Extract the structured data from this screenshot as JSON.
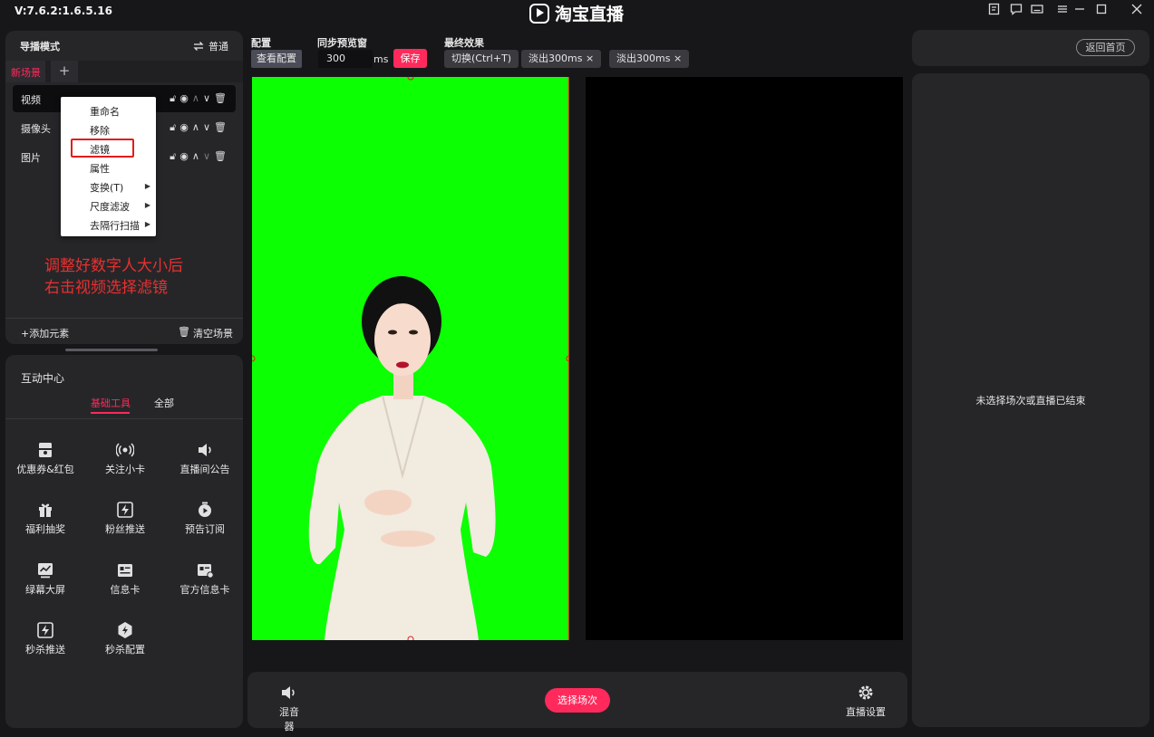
{
  "app": {
    "version": "V:7.6.2:1.6.5.16",
    "brand": "淘宝直播"
  },
  "scene_panel": {
    "mode_label": "导播模式",
    "mode_toggle_label": "普通",
    "active_tab": "新场景",
    "add_tab": "+",
    "layers": [
      {
        "label": "视频"
      },
      {
        "label": "摄像头"
      },
      {
        "label": "图片"
      }
    ],
    "add_element": "+添加元素",
    "clear_scene": "清空场景"
  },
  "context_menu": {
    "items": [
      {
        "label": "重命名"
      },
      {
        "label": "移除"
      },
      {
        "label": "滤镜"
      },
      {
        "label": "属性"
      },
      {
        "label": "变换(T)"
      },
      {
        "label": "尺度滤波"
      },
      {
        "label": "去隔行扫描"
      }
    ],
    "highlighted_item": "滤镜"
  },
  "annotation": {
    "line1": "调整好数字人大小后",
    "line2": "右击视频选择滤镜"
  },
  "interact": {
    "title": "互动中心",
    "tabs": [
      {
        "label": "基础工具",
        "active": true
      },
      {
        "label": "全部",
        "active": false
      }
    ],
    "tools": [
      {
        "label": "优惠券&红包",
        "icon": "coupon-icon"
      },
      {
        "label": "关注小卡",
        "icon": "broadcast-icon"
      },
      {
        "label": "直播间公告",
        "icon": "speaker-icon"
      },
      {
        "label": "福利抽奖",
        "icon": "gift-icon"
      },
      {
        "label": "粉丝推送",
        "icon": "lightning-icon"
      },
      {
        "label": "预告订阅",
        "icon": "alarm-icon"
      },
      {
        "label": "绿幕大屏",
        "icon": "chart-icon"
      },
      {
        "label": "信息卡",
        "icon": "id-card-icon"
      },
      {
        "label": "官方信息卡",
        "icon": "official-card-icon"
      },
      {
        "label": "秒杀推送",
        "icon": "flash-icon"
      },
      {
        "label": "秒杀配置",
        "icon": "flash-gear-icon"
      }
    ]
  },
  "toolbar": {
    "config_label": "配置",
    "view_config_button": "查看配置",
    "sync_label": "同步预览窗",
    "sync_value": "300",
    "sync_unit": "ms",
    "save_button": "保存",
    "effect_label": "最终效果",
    "switch_button": "切换(Ctrl+T)",
    "fade_chip_1": "淡出300ms ×",
    "fade_chip_2": "淡出300ms ×"
  },
  "right_panel": {
    "back_home": "返回首页",
    "status": "未选择场次或直播已结束"
  },
  "bottom_bar": {
    "mixer": "混音器",
    "select_session": "选择场次",
    "live_settings": "直播设置"
  },
  "colors": {
    "accent": "#ff2a5b",
    "green_screen": "#0dff04",
    "panel": "#262629",
    "background": "#17171a",
    "highlight_box": "#e21d1d"
  }
}
